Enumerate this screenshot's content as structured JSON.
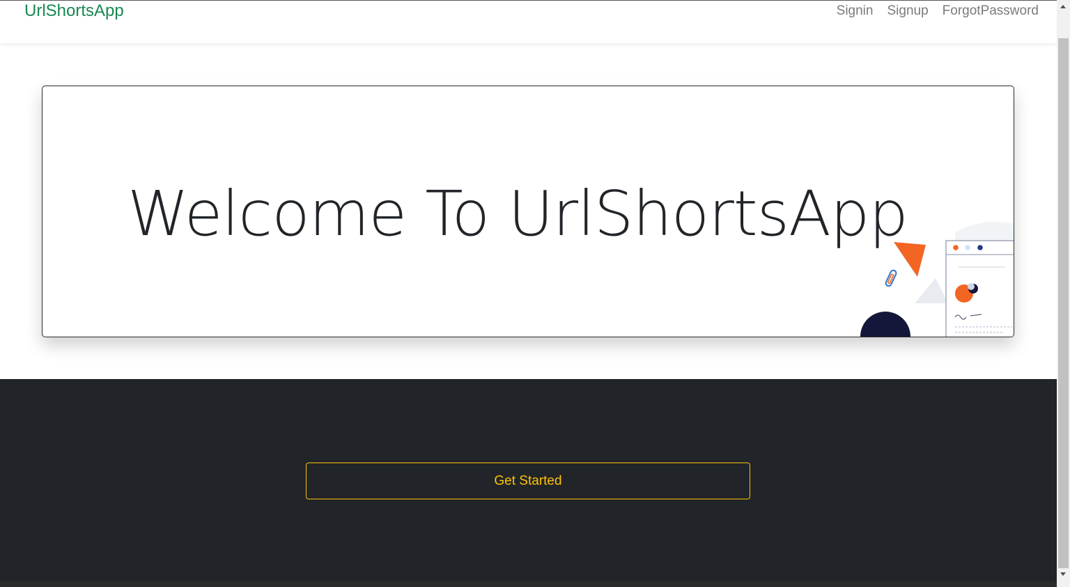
{
  "navbar": {
    "brand": "UrlShortsApp",
    "links": [
      {
        "label": "Signin"
      },
      {
        "label": "Signup"
      },
      {
        "label": "ForgotPassword"
      }
    ]
  },
  "hero": {
    "title": "Welcome To UrlShortsApp"
  },
  "cta": {
    "label": "Get Started"
  },
  "colors": {
    "brand": "#198754",
    "accent": "#ffc107",
    "dark_section": "#212529",
    "illustration_orange": "#f26522",
    "illustration_navy": "#14163a"
  }
}
